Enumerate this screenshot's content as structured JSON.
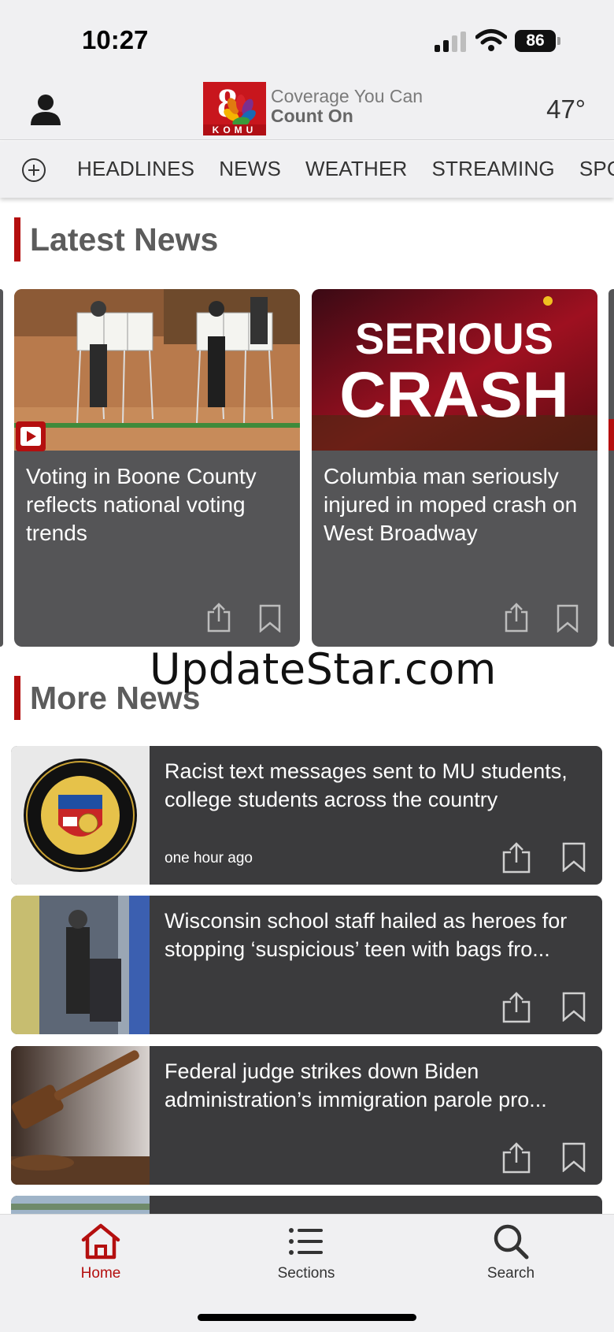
{
  "status_bar": {
    "time": "10:27",
    "battery": "86"
  },
  "header": {
    "logo_text": "KOMU",
    "logo_number": "8",
    "tagline_line1": "Coverage You Can",
    "tagline_line2": "Count On",
    "temperature": "47°"
  },
  "nav": {
    "items": [
      "HEADLINES",
      "NEWS",
      "WEATHER",
      "STREAMING",
      "SPORTS"
    ]
  },
  "latest_news": {
    "title": "Latest News",
    "cards": [
      {
        "title": "Voting in Boone County reflects national voting trends",
        "has_video": true
      },
      {
        "title": "Columbia man seriously injured in moped crash on West Broadway",
        "image_text_line1": "SERIOUS",
        "image_text_line2": "CRASH"
      }
    ]
  },
  "watermark": "UpdateStar.com",
  "more_news": {
    "title": "More News",
    "items": [
      {
        "title": "Racist text messages sent to MU students, college students across the country",
        "time": "one hour ago"
      },
      {
        "title": "Wisconsin school staff hailed as heroes for stopping ‘suspicious’ teen with bags fro...",
        "time": ""
      },
      {
        "title": "Federal judge strikes down Biden administration’s immigration parole pro...",
        "time": ""
      }
    ]
  },
  "tab_bar": {
    "home": "Home",
    "sections": "Sections",
    "search": "Search"
  },
  "colors": {
    "accent": "#b40f0f",
    "card": "#555557",
    "list_card": "#3b3b3d",
    "bar": "#f0f0f2"
  }
}
